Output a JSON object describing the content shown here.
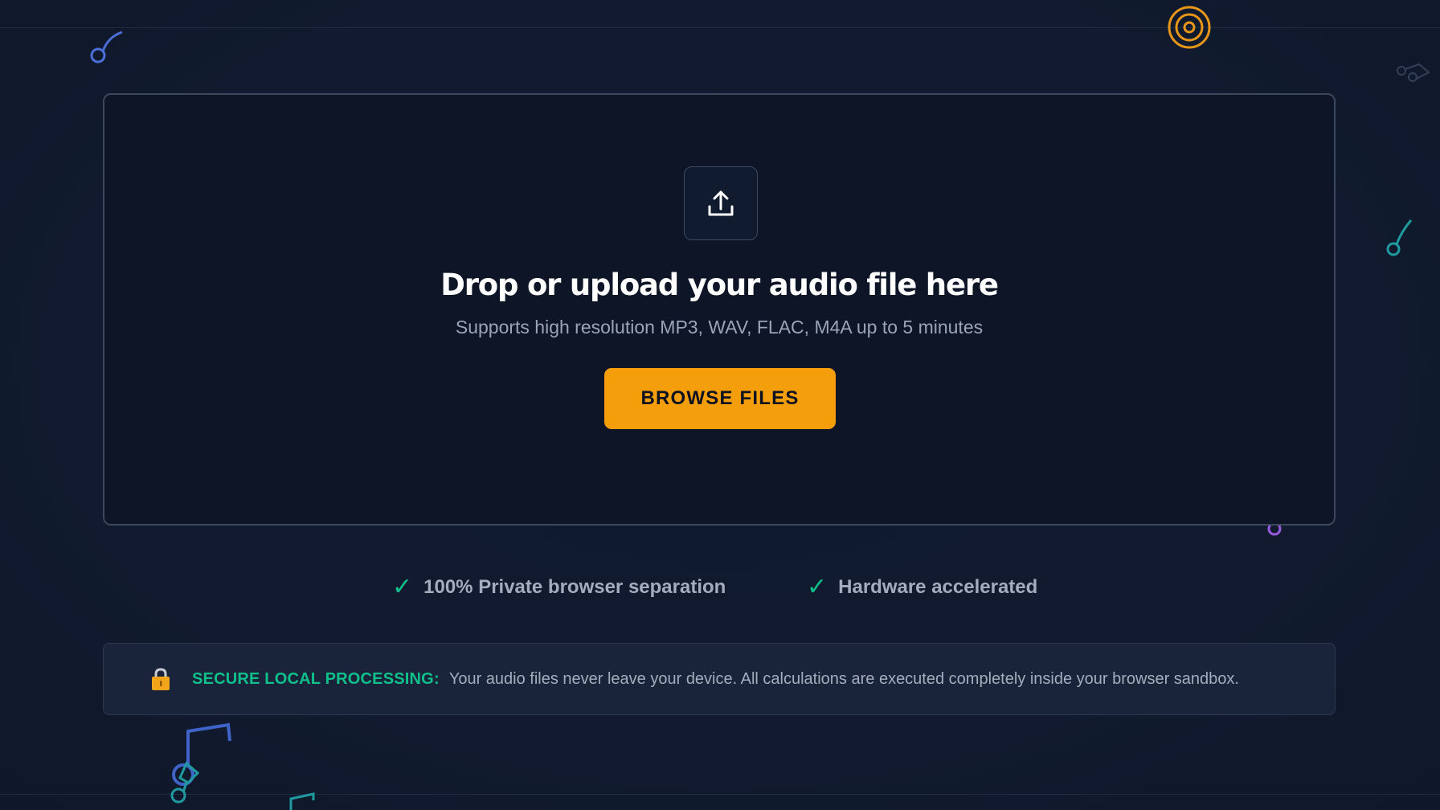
{
  "dropzone": {
    "title": "Drop or upload your audio file here",
    "subtitle": "Supports high resolution MP3, WAV, FLAC, M4A up to 5 minutes",
    "browse_button": "BROWSE FILES",
    "upload_icon": "upload-icon"
  },
  "features": [
    {
      "icon": "check-icon",
      "label": "100% Private browser separation"
    },
    {
      "icon": "check-icon",
      "label": "Hardware accelerated"
    }
  ],
  "secure_banner": {
    "icon": "lock-icon",
    "label": "SECURE LOCAL PROCESSING:",
    "text": "Your audio files never leave your device. All calculations are executed completely inside your browser sandbox."
  },
  "decorations": [
    "music-note-icon",
    "vinyl-record-icon",
    "music-note-icon",
    "music-note-icon",
    "music-note-icon",
    "music-note-icon"
  ],
  "colors": {
    "background": "#111a2e",
    "dropzone_bg": "#0d1527",
    "accent_orange": "#f59e0b",
    "accent_green": "#10c08a",
    "text_muted": "#9aa5b8"
  }
}
